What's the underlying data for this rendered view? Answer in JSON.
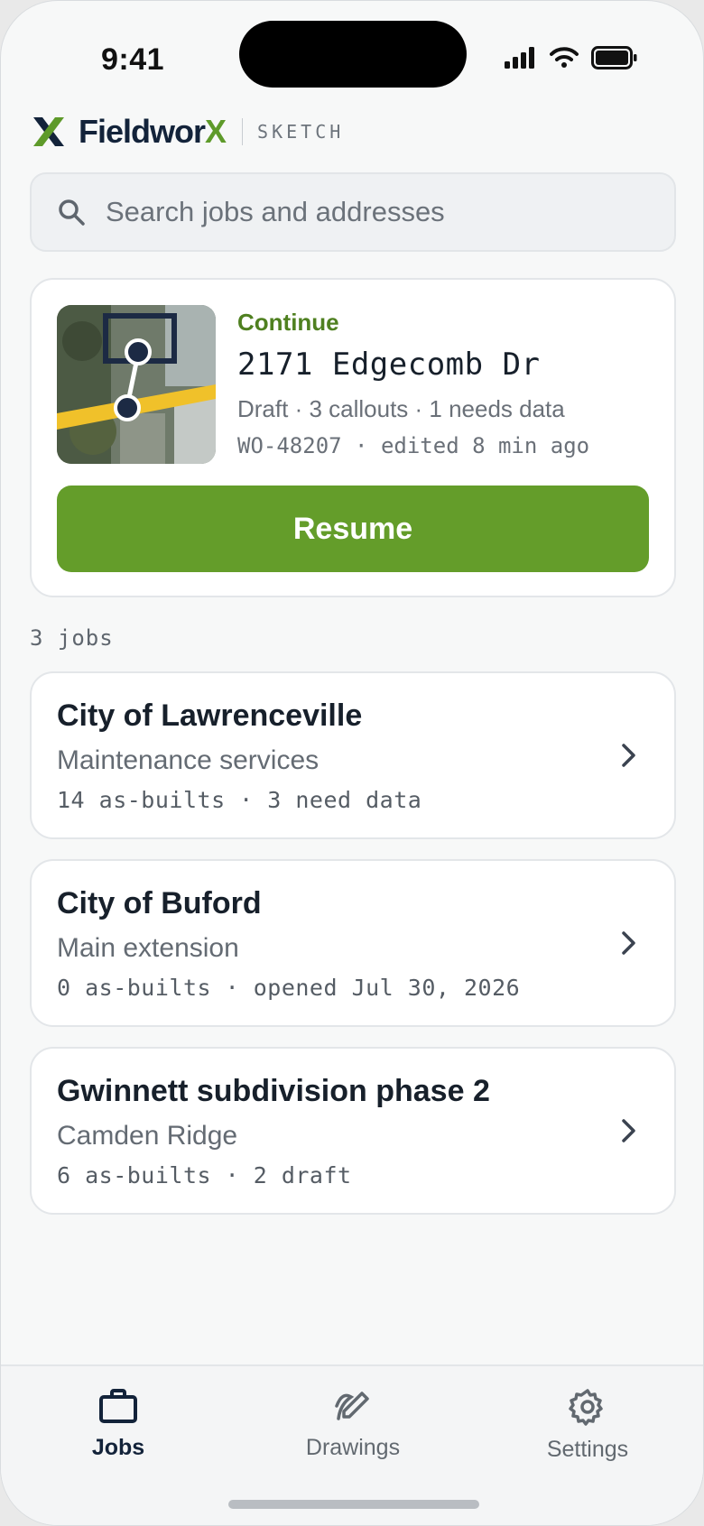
{
  "status_bar": {
    "time": "9:41"
  },
  "brand": {
    "name_main": "Fieldwor",
    "name_accent": "X",
    "subtitle": "SKETCH"
  },
  "search": {
    "placeholder": "Search jobs and addresses"
  },
  "continue_card": {
    "label": "Continue",
    "address": "2171 Edgecomb Dr",
    "meta": "Draft · 3 callouts · 1 needs data",
    "work_order": "WO-48207 · edited 8 min ago",
    "button_label": "Resume"
  },
  "jobs_count": "3 jobs",
  "jobs": [
    {
      "title": "City of Lawrenceville",
      "subtitle": "Maintenance services",
      "meta": "14 as-builts · 3 need data"
    },
    {
      "title": "City of Buford",
      "subtitle": "Main extension",
      "meta": "0 as-builts · opened Jul 30, 2026"
    },
    {
      "title": "Gwinnett subdivision phase 2",
      "subtitle": "Camden Ridge",
      "meta": "6 as-builts · 2 draft"
    }
  ],
  "tabs": [
    {
      "label": "Jobs",
      "icon": "briefcase-icon",
      "active": true
    },
    {
      "label": "Drawings",
      "icon": "pencil-drawing-icon",
      "active": false
    },
    {
      "label": "Settings",
      "icon": "gear-icon",
      "active": false
    }
  ],
  "colors": {
    "accent": "#649d2a",
    "brand_navy": "#13233a",
    "continue_label": "#4f8020"
  }
}
